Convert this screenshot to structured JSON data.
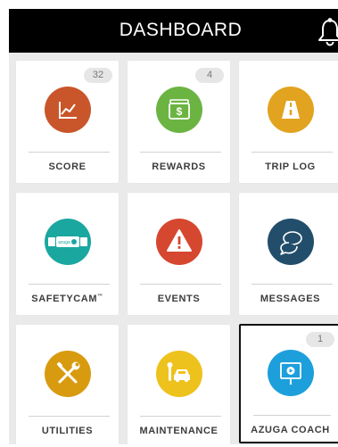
{
  "header": {
    "title": "DASHBOARD"
  },
  "colors": {
    "header_bg": "#000000",
    "grid_bg": "#eaeaea",
    "score": "#c9552a",
    "rewards": "#6bb442",
    "trip_log": "#e1a320",
    "safetycam": "#1aa7a0",
    "events": "#d6472f",
    "messages": "#234e6b",
    "utilities": "#d89b10",
    "maintenance": "#eec21d",
    "azuga_coach": "#1d9fdc"
  },
  "tiles": [
    {
      "label": "SCORE",
      "badge": "32",
      "icon": "line-chart-icon"
    },
    {
      "label": "REWARDS",
      "badge": "4",
      "icon": "wallet-dollar-icon"
    },
    {
      "label": "TRIP LOG",
      "icon": "road-icon"
    },
    {
      "label": "SAFETYCAM",
      "label_mark": "™",
      "icon": "dashcam-icon",
      "camera_brand": "azuga"
    },
    {
      "label": "EVENTS",
      "icon": "warning-icon"
    },
    {
      "label": "MESSAGES",
      "icon": "chat-bubbles-icon"
    },
    {
      "label": "UTILITIES",
      "icon": "tools-icon"
    },
    {
      "label": "MAINTENANCE",
      "icon": "car-wrench-icon"
    },
    {
      "label": "AZUGA COACH",
      "badge": "1",
      "icon": "video-screen-icon",
      "selected": true
    }
  ]
}
